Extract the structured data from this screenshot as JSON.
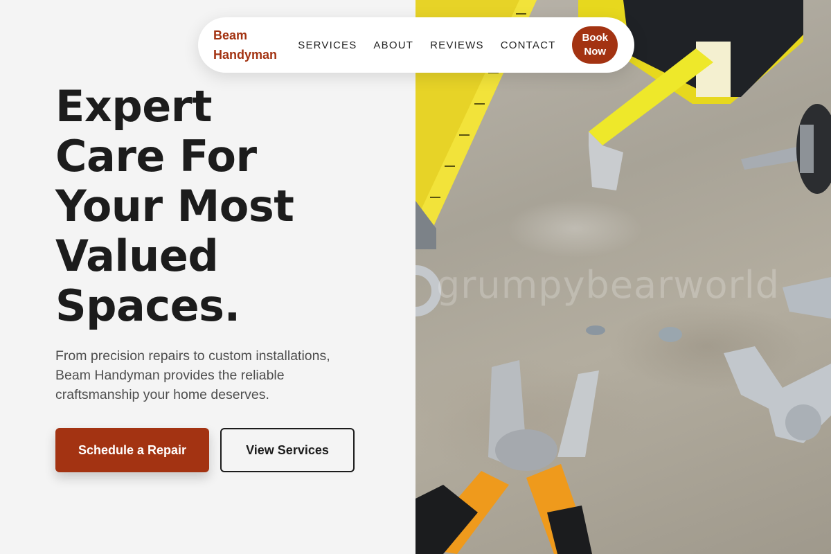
{
  "brand": {
    "name": "Beam Handyman",
    "color": "#a33312"
  },
  "nav": {
    "links": [
      "SERVICES",
      "ABOUT",
      "REVIEWS",
      "CONTACT"
    ],
    "book_label": "Book Now"
  },
  "hero": {
    "title_lines": [
      "Expert",
      "Care For",
      "Your Most",
      "Valued",
      "Spaces."
    ],
    "subtitle": "From precision repairs to custom installations, Beam Handyman provides the reliable craftsmanship your home deserves.",
    "primary_cta": "Schedule a Repair",
    "secondary_cta": "View Services"
  },
  "photo": {
    "watermark": "grumpybearworld"
  },
  "colors": {
    "accent": "#a33312",
    "background": "#f4f4f4",
    "text": "#1c1c1c",
    "muted": "#4e4e4e"
  }
}
